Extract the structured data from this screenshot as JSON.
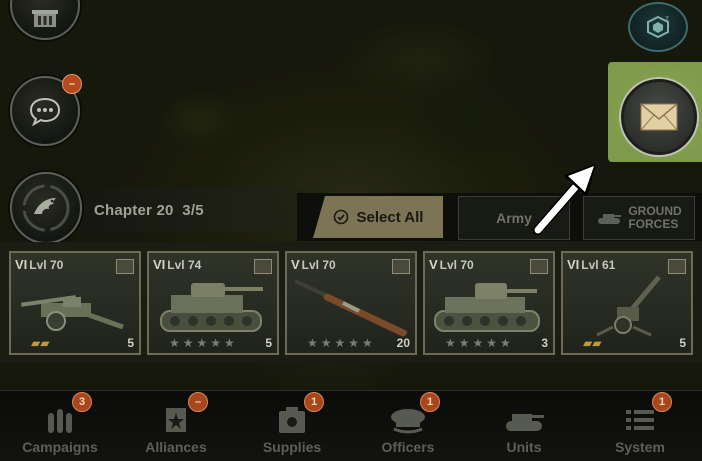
{
  "chapter": {
    "label": "Chapter 20",
    "progress": "3/5"
  },
  "actions": {
    "select_all": "Select All",
    "army": "Army",
    "ground_forces_line1": "GROUND",
    "ground_forces_line2": "FORCES"
  },
  "left_buttons": {
    "chat_badge": "–"
  },
  "units": [
    {
      "rank": "VI",
      "level": "Lvl 70",
      "count": "5",
      "stars": "",
      "art": "howitzer-icon"
    },
    {
      "rank": "VI",
      "level": "Lvl 74",
      "count": "5",
      "stars": "★★★★★",
      "art": "tank-icon"
    },
    {
      "rank": "V",
      "level": "Lvl 70",
      "count": "20",
      "stars": "★★★★★",
      "art": "rifle-icon"
    },
    {
      "rank": "V",
      "level": "Lvl 70",
      "count": "3",
      "stars": "★★★★★",
      "art": "tank-icon"
    },
    {
      "rank": "VI",
      "level": "Lvl 61",
      "count": "5",
      "stars": "",
      "art": "artillery-icon"
    }
  ],
  "nav": [
    {
      "label": "Campaigns",
      "badge": "3"
    },
    {
      "label": "Alliances",
      "badge": "–"
    },
    {
      "label": "Supplies",
      "badge": "1"
    },
    {
      "label": "Officers",
      "badge": "1"
    },
    {
      "label": "Units",
      "badge": ""
    },
    {
      "label": "System",
      "badge": "1"
    }
  ],
  "colors": {
    "highlight": "#8da75c",
    "badge": "#b5481e",
    "select_all_bg": "#7d7456"
  }
}
